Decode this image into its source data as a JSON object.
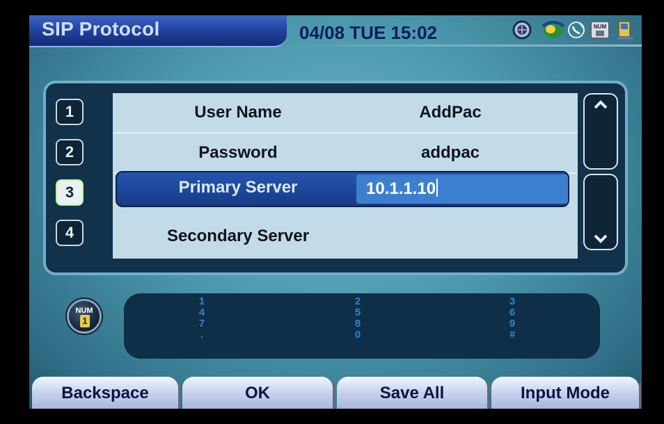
{
  "header": {
    "title": "SIP Protocol",
    "datetime": "04/08 TUE 15:02",
    "status_icons": [
      "globe-icon",
      "network-icon",
      "phone-icon",
      "num-keyboard-icon",
      "computer-icon"
    ],
    "status_num_text": "NUM"
  },
  "list": {
    "row_numbers": [
      "1",
      "2",
      "3",
      "4"
    ],
    "selected_index": 3,
    "rows": [
      {
        "label": "User Name",
        "value": "AddPac"
      },
      {
        "label": "Password",
        "value": "addpac"
      },
      {
        "label": "Primary Server",
        "value": "10.1.1.10"
      },
      {
        "label": "Secondary Server",
        "value": ""
      }
    ]
  },
  "keypad": {
    "mode_label": "NUM",
    "mode_value": "1",
    "columns": [
      [
        "1",
        "4",
        "7",
        "."
      ],
      [
        "2",
        "5",
        "8",
        "0"
      ],
      [
        "3",
        "6",
        "9",
        "#"
      ]
    ]
  },
  "softkeys": {
    "backspace": "Backspace",
    "ok": "OK",
    "save_all": "Save All",
    "input_mode": "Input Mode"
  },
  "colors": {
    "title_tab": "#1f3f9a",
    "selection": "#173b86",
    "input_highlight": "#3d7fcf",
    "keypad_text": "#2d86d2"
  }
}
